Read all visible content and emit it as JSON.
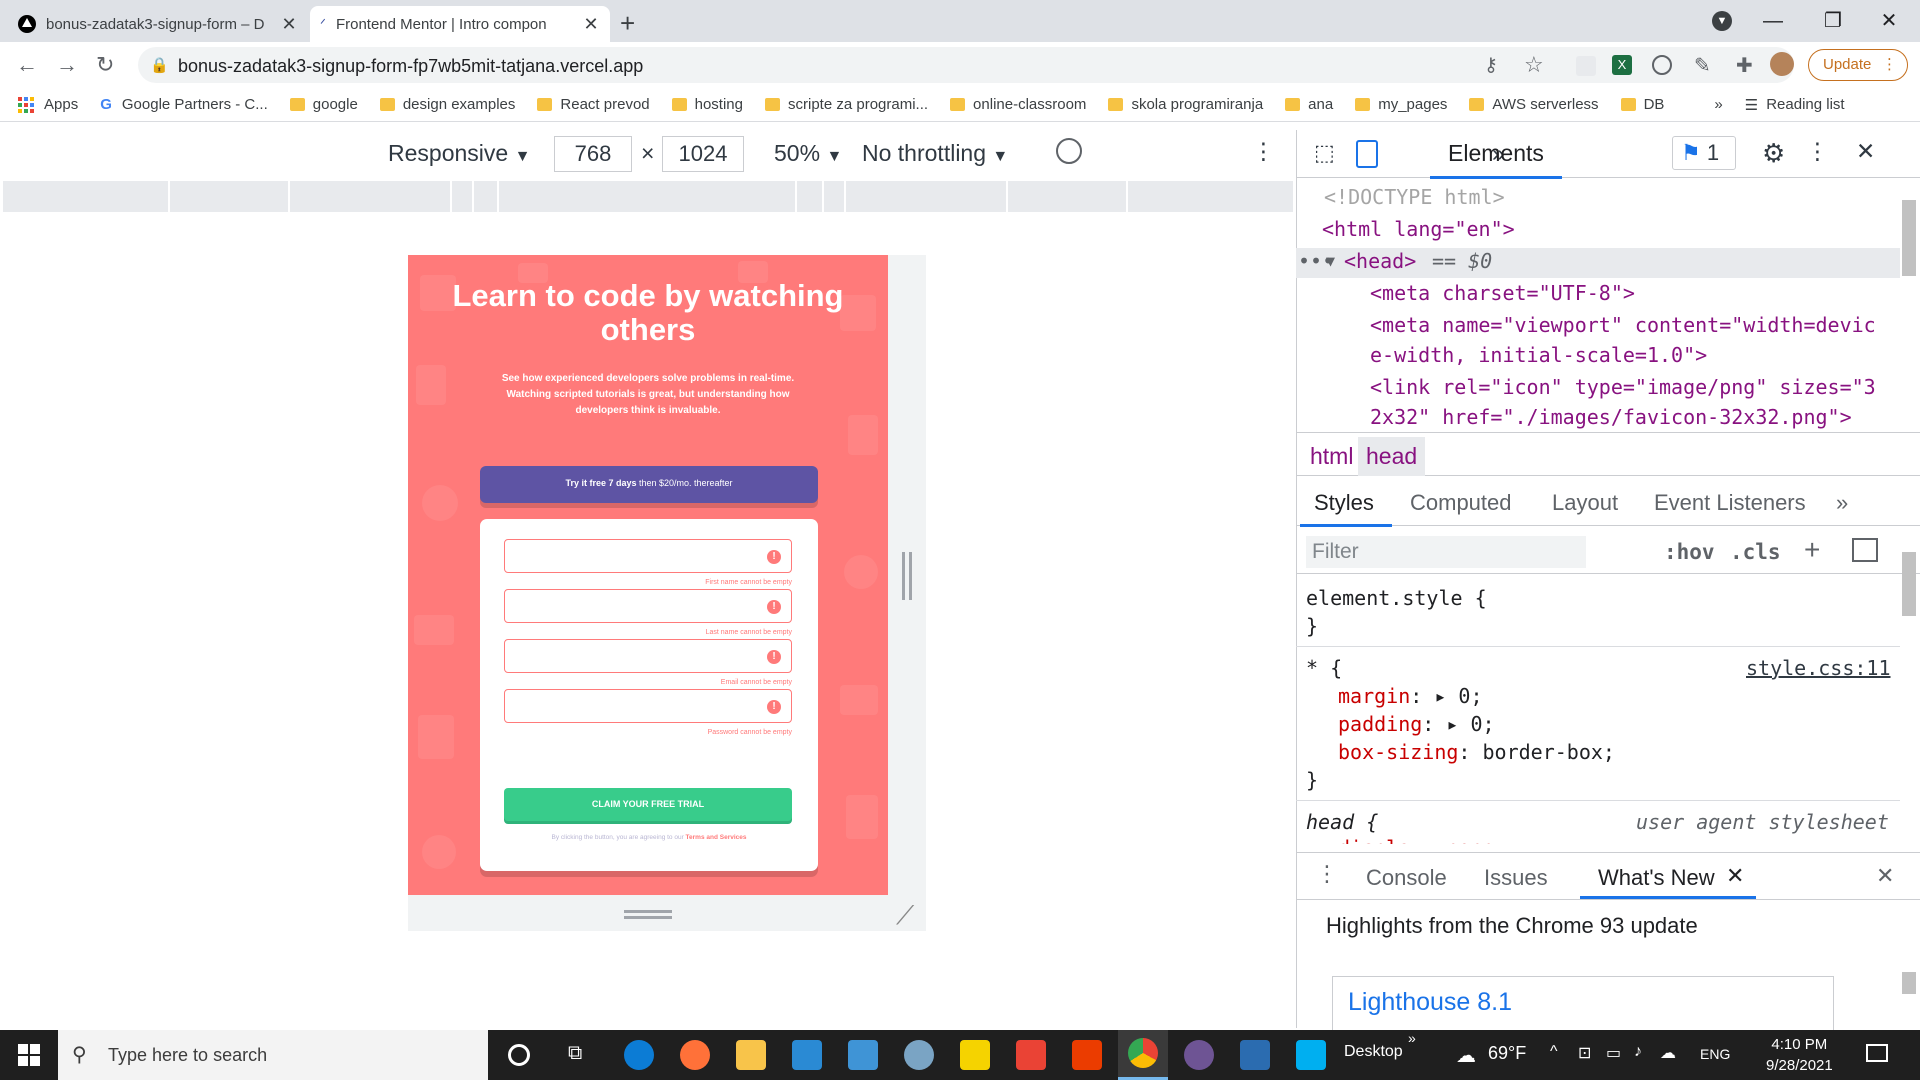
{
  "browser": {
    "tabs": [
      {
        "title": "bonus-zadatak3-signup-form – D",
        "active": false
      },
      {
        "title": "Frontend Mentor | Intro compon",
        "active": true
      }
    ],
    "url": "bonus-zadatak3-signup-form-fp7wb5mit-tatjana.vercel.app",
    "update_label": "Update",
    "bookmarks": [
      "Apps",
      "Google Partners - C...",
      "google",
      "design examples",
      "React prevod",
      "hosting",
      "scripte za programi...",
      "online-classroom",
      "skola programiranja",
      "ana",
      "my_pages",
      "AWS serverless",
      "DB"
    ],
    "reading_list": "Reading list"
  },
  "device_toolbar": {
    "mode": "Responsive",
    "width": "768",
    "times": "×",
    "height": "1024",
    "zoom": "50%",
    "throttle": "No throttling"
  },
  "page": {
    "hero_title": "Learn to code by watching others",
    "hero_sub": "See how experienced developers solve problems in real-time. Watching scripted tutorials is great, but understanding how developers think is invaluable.",
    "promo_bold": "Try it free 7 days",
    "promo_rest": " then $20/mo. thereafter",
    "errors": [
      "First name cannot be empty",
      "Last name cannot be empty",
      "Email cannot be empty",
      "Password cannot be empty"
    ],
    "error_icon": "!",
    "claim_button": "CLAIM YOUR FREE TRIAL",
    "terms_prefix": "By clicking the button, you are agreeing to our ",
    "terms_link": "Terms and Services"
  },
  "devtools": {
    "elements_tab": "Elements",
    "issues_count": "1",
    "dom_lines": {
      "doctype": "<!DOCTYPE html>",
      "html_open": "<html lang=\"en\">",
      "head_open": "<head>",
      "head_eq": "== $0",
      "meta1": "<meta charset=\"UTF-8\">",
      "meta2a": "<meta name=\"viewport\" content=\"width=devic",
      "meta2b": "e-width, initial-scale=1.0\">",
      "link1": "<link rel=\"icon\" type=\"image/png\" sizes=\"3",
      "link2": "2x32\" href=\"./images/favicon-32x32.png\">"
    },
    "breadcrumb": [
      "html",
      "head"
    ],
    "styles_tabs": [
      "Styles",
      "Computed",
      "Layout",
      "Event Listeners"
    ],
    "filter_placeholder": "Filter",
    "hov": ":hov",
    "cls": ".cls",
    "css": {
      "element_style": "element.style {",
      "close": "}",
      "star_sel": "* {",
      "star_src": "style.css:11",
      "margin_prop": "margin",
      "margin_val": "0;",
      "padding_prop": "padding",
      "padding_val": "0;",
      "boxsizing_prop": "box-sizing",
      "boxsizing_val": "border-box;",
      "head_sel": "head {",
      "head_src": "user agent stylesheet",
      "display_cut": "display: none;"
    },
    "drawer_tabs": [
      "Console",
      "Issues",
      "What's New"
    ],
    "highlights": "Highlights from the Chrome 93 update",
    "lighthouse": "Lighthouse 8.1"
  },
  "taskbar": {
    "search_placeholder": "Type here to search",
    "desktop": "Desktop",
    "weather": "69°F",
    "lang": "ENG",
    "time": "4:10 PM",
    "date": "9/28/2021"
  },
  "colors": {
    "page_red": "#ff7a7a",
    "promo_purple": "#5e54a4",
    "claim_green": "#38cc8b",
    "devtools_blue": "#1a73e8"
  }
}
